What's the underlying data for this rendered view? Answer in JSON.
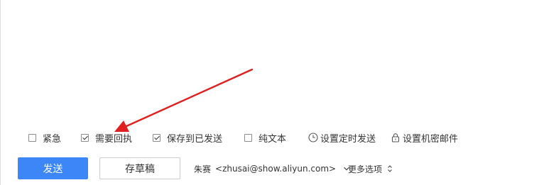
{
  "options": {
    "urgent": {
      "label": "紧急",
      "checked": false
    },
    "read_receipt": {
      "label": "需要回执",
      "checked": true
    },
    "save_to_sent": {
      "label": "保存到已发送",
      "checked": true
    },
    "plain_text": {
      "label": "纯文本",
      "checked": false
    },
    "scheduled_send": {
      "label": "设置定时发送",
      "icon": "clock-icon"
    },
    "confidential": {
      "label": "设置机密邮件",
      "icon": "lock-icon"
    }
  },
  "actions": {
    "send_label": "发送",
    "draft_label": "存草稿"
  },
  "sender": {
    "name": "朱赛",
    "address": "<zhusai@show.aliyun.com>"
  },
  "more_options_label": "更多选项",
  "colors": {
    "primary": "#3d86f7",
    "annotation_arrow": "#e02020"
  },
  "annotation": {
    "type": "arrow",
    "points_to": "需要回执"
  }
}
